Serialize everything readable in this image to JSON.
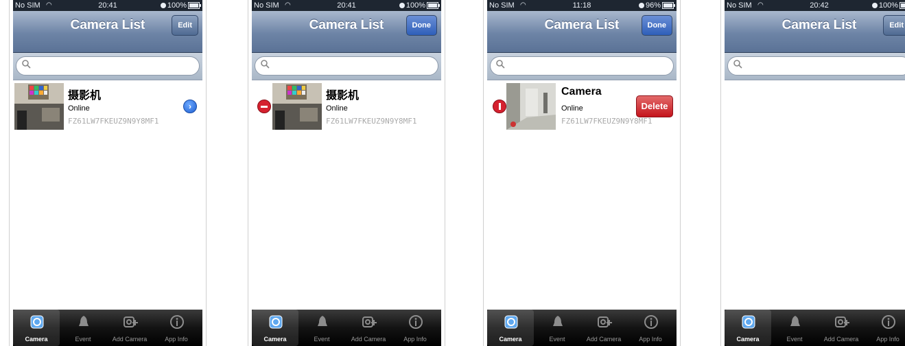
{
  "status": {
    "carrier": "No SIM"
  },
  "screens": [
    {
      "time": "20:41",
      "battery": "100%",
      "nav": {
        "title": "Camera List",
        "button": "Edit"
      },
      "camera": {
        "name": "摄影机",
        "status": "Online",
        "id": "FZ61LW7FKEUZ9N9Y8MF1"
      }
    },
    {
      "time": "20:41",
      "battery": "100%",
      "nav": {
        "title": "Camera List",
        "button": "Done"
      },
      "camera": {
        "name": "摄影机",
        "status": "Online",
        "id": "FZ61LW7FKEUZ9N9Y8MF1"
      }
    },
    {
      "time": "11:18",
      "battery": "96%",
      "nav": {
        "title": "Camera List",
        "button": "Done"
      },
      "camera": {
        "name": "Camera",
        "status": "Online",
        "id": "FZ61LW7FKEUZ9N9Y8MF1",
        "delete": "Delete"
      }
    },
    {
      "time": "20:42",
      "battery": "100%",
      "nav": {
        "title": "Camera List",
        "button": "Edit"
      }
    }
  ],
  "tabs": [
    {
      "label": "Camera",
      "icon": "camera-icon"
    },
    {
      "label": "Event",
      "icon": "bell-icon"
    },
    {
      "label": "Add Camera",
      "icon": "add-camera-icon"
    },
    {
      "label": "App Info",
      "icon": "info-icon"
    }
  ],
  "colors": {
    "nav_top": "#a9b8ce",
    "nav_bottom": "#5b7296",
    "delete_red": "#c5141c",
    "disclosure_blue": "#1f5fd1"
  }
}
